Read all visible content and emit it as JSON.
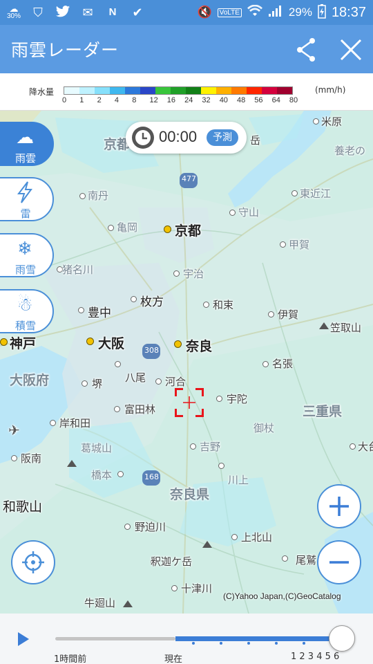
{
  "status_bar": {
    "weather_temp": "30%",
    "battery": "29%",
    "network": "VoLTE",
    "time": "18:37"
  },
  "header": {
    "title": "雨雲レーダー"
  },
  "legend": {
    "title": "降水量",
    "unit": "(mm/h)",
    "ticks": [
      "0",
      "1",
      "2",
      "4",
      "8",
      "12",
      "16",
      "24",
      "32",
      "40",
      "48",
      "56",
      "64",
      "80"
    ],
    "colors": [
      "#e8fbff",
      "#bff2ff",
      "#86e0fb",
      "#3fb8ef",
      "#2c79db",
      "#2a46c8",
      "#39c53b",
      "#20a028",
      "#128017",
      "#fff200",
      "#ffb000",
      "#ff7a00",
      "#ff2600",
      "#d4003c",
      "#a0002e"
    ]
  },
  "side_buttons": [
    {
      "label": "雨雲",
      "icon": "rain-cloud-icon"
    },
    {
      "label": "雷",
      "icon": "lightning-icon"
    },
    {
      "label": "雨雪",
      "icon": "rain-snow-icon"
    },
    {
      "label": "積雪",
      "icon": "snowman-icon"
    }
  ],
  "time_display": {
    "time": "00:00",
    "badge": "予測"
  },
  "map": {
    "labels": {
      "kyoto": "京都",
      "osaka": "大阪",
      "nara": "奈良",
      "kobe": "神戸",
      "osaka_pref": "大阪府",
      "nara_pref": "奈良県",
      "mie_pref": "三重県",
      "wakayama": "和歌山",
      "kyo": "京都",
      "nantan": "南丹",
      "kameoka": "亀岡",
      "moriyama": "守山",
      "higashiomi": "東近江",
      "koka": "甲賀",
      "yonehara": "米原",
      "yorono": "養老の",
      "inagawa": "猪名川",
      "toyonaka": "豊中",
      "hirakata": "枚方",
      "uji": "宇治",
      "wazuka": "和束",
      "iga": "伊賀",
      "kasatoriyama": "笠取山",
      "nabari": "名張",
      "sakai": "堺",
      "yao": "八尾",
      "kawai": "河合",
      "uda": "宇陀",
      "tondabayashi": "富田林",
      "kishiwada": "岸和田",
      "mitsue": "御杖",
      "katsuragi": "葛城山",
      "hannan": "阪南",
      "hashimoto": "橋本",
      "yoshino": "吉野",
      "kawakami": "川上",
      "nosegawa": "野迫川",
      "kamikitayama": "上北山",
      "shakagatake": "釈迦ケ岳",
      "owase": "尾鷲",
      "totsukawa": "十津川",
      "ushiroyama": "牛廻山",
      "odai": "大台",
      "dake": "岳",
      "route_477": "477",
      "route_308": "308",
      "route_168": "168"
    },
    "copyright": "(C)Yahoo Japan,(C)GeoCatalog"
  },
  "timeline": {
    "label_past": "1時間前",
    "label_now": "現在",
    "hours": [
      "1",
      "2",
      "3",
      "4",
      "5",
      "6"
    ],
    "position": 1.0
  }
}
